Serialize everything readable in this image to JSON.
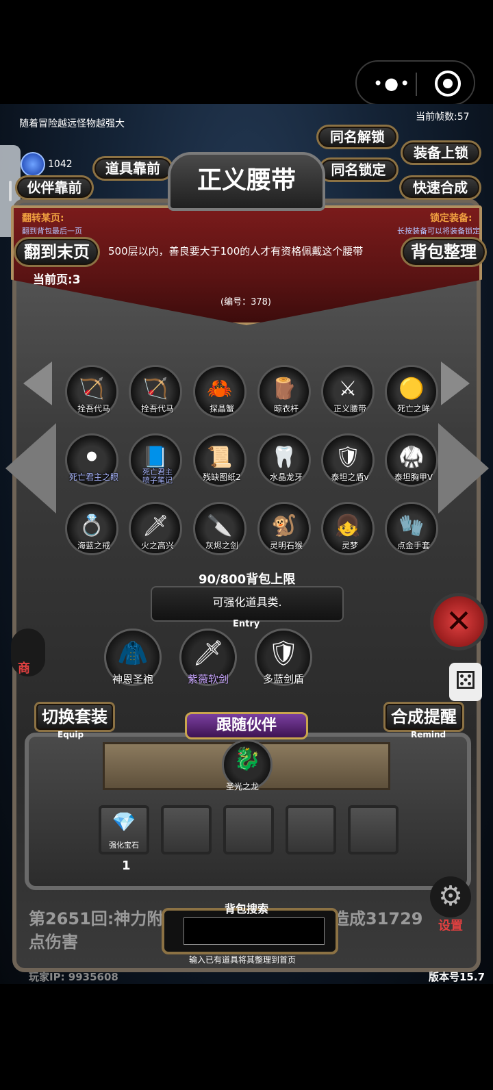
{
  "topbar": {
    "menu_icon": "more-dots-icon",
    "close_icon": "target-circle-icon"
  },
  "notes": {
    "left": "随着冒险越远怪物越强大",
    "fps": "当前帧数:57"
  },
  "currency": {
    "value": "1042",
    "icon": "blue-crystal-icon"
  },
  "buttons": {
    "item_front": "道具靠前",
    "partner_front": "伙伴靠前",
    "same_unlock": "同名解锁",
    "same_lock": "同名锁定",
    "equip_lock": "装备上锁",
    "quick_merge": "快速合成",
    "to_last_page": "翻到末页",
    "bag_sort": "背包整理",
    "switch_set": "切换套装",
    "switch_set_sub": "Equip",
    "merge_remind": "合成提醒",
    "merge_remind_sub": "Remind",
    "follow_partner": "跟随伙伴",
    "settings": "设置"
  },
  "item_detail": {
    "name": "正义腰带",
    "desc": "500层以内，善良要大于100的人才有资格佩戴这个腰带",
    "id_text": "(编号：378)"
  },
  "hints": {
    "flip_title": "翻转某页:",
    "flip_desc": "翻到背包最后一页",
    "lock_title": "锁定装备:",
    "lock_desc": "长按装备可以将装备锁定"
  },
  "current_page": "当前页:3",
  "items": [
    {
      "label": "拴吾代马",
      "icon": "🏹",
      "color": "white"
    },
    {
      "label": "拴吾代马",
      "icon": "🏹",
      "color": "white"
    },
    {
      "label": "探晶蟹",
      "icon": "🦀",
      "color": "white"
    },
    {
      "label": "晾衣杆",
      "icon": "🪵",
      "color": "white"
    },
    {
      "label": "正义腰带",
      "icon": "⚔",
      "color": "white"
    },
    {
      "label": "死亡之眸",
      "icon": "🟡",
      "color": "white"
    },
    {
      "label": "死亡君主之眼",
      "icon": "⚫",
      "color": "blue"
    },
    {
      "label": "死亡君主",
      "label2": "喷子笔记",
      "icon": "📘",
      "color": "blue"
    },
    {
      "label": "残缺图纸2",
      "icon": "📜",
      "color": "white"
    },
    {
      "label": "水晶龙牙",
      "icon": "🦷",
      "color": "white"
    },
    {
      "label": "泰坦之盾v",
      "icon": "🛡",
      "color": "white"
    },
    {
      "label": "泰坦胸甲V",
      "icon": "🥋",
      "color": "white"
    },
    {
      "label": "海蓝之戒",
      "icon": "💍",
      "color": "white"
    },
    {
      "label": "火之高兴",
      "icon": "🗡",
      "color": "white"
    },
    {
      "label": "灰烬之剑",
      "icon": "🔪",
      "color": "white"
    },
    {
      "label": "灵明石猴",
      "icon": "🐒",
      "color": "white"
    },
    {
      "label": "灵梦",
      "icon": "👧",
      "color": "white"
    },
    {
      "label": "点金手套",
      "icon": "🧤",
      "color": "white"
    }
  ],
  "bag_limit": "90/800背包上限",
  "entry": {
    "title": "可强化道具类.",
    "sub": "Entry"
  },
  "equipped": [
    {
      "label": "神恩圣袍",
      "icon": "🧥"
    },
    {
      "label": "紫薇软剑",
      "icon": "🗡"
    },
    {
      "label": "多蓝剑盾",
      "icon": "🛡"
    }
  ],
  "partner": {
    "label": "圣光之龙",
    "icon": "🐉"
  },
  "material": {
    "label": "强化宝石",
    "icon": "💎",
    "count": "1"
  },
  "side": {
    "shop": "商"
  },
  "battle_log": {
    "line1a": "第2651回:神力附",
    "line1b": "造成31729",
    "line2": "点伤害"
  },
  "search": {
    "title": "背包搜索",
    "hint": "输入已有道具将其整理到首页",
    "value": ""
  },
  "footer": {
    "ip": "玩家IP:  9935608",
    "version": "版本号15.7"
  }
}
